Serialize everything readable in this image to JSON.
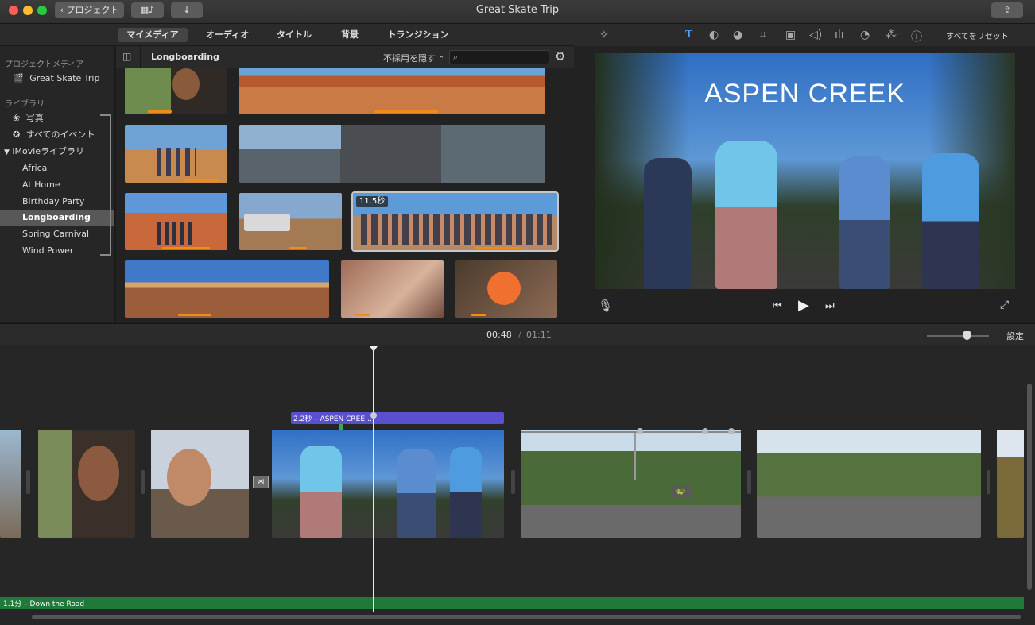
{
  "window": {
    "title": "Great Skate Trip",
    "back_label": "プロジェクト"
  },
  "browser_tabs": [
    "マイメディア",
    "オーディオ",
    "タイトル",
    "背景",
    "トランジション"
  ],
  "sidebar": {
    "project_media_header": "プロジェクトメディア",
    "project_item": "Great Skate Trip",
    "library_header": "ライブラリ",
    "photos": "写真",
    "all_events": "すべてのイベント",
    "imovie_library": "iMovieライブラリ",
    "events": [
      "Africa",
      "At Home",
      "Birthday Party",
      "Longboarding",
      "Spring Carnival",
      "Wind Power"
    ],
    "selected_event": "Longboarding"
  },
  "browser": {
    "event_title": "Longboarding",
    "filter_label": "不採用を隠す",
    "search_placeholder": "",
    "badge": "11.5秒"
  },
  "viewer": {
    "reset_label": "すべてをリセット",
    "preview_title": "ASPEN CREEK"
  },
  "timeline": {
    "current_time": "00:48",
    "separator": "/",
    "total_time": "01:11",
    "settings_label": "設定",
    "title_clip_label": "2.2秒 – ASPEN CREE…",
    "music_label": "1.1分 – Down the Road"
  },
  "colors": {
    "accent_orange": "#f08c18",
    "title_bar_purple": "#5a4fcf",
    "music_green": "#1f7a3a"
  }
}
